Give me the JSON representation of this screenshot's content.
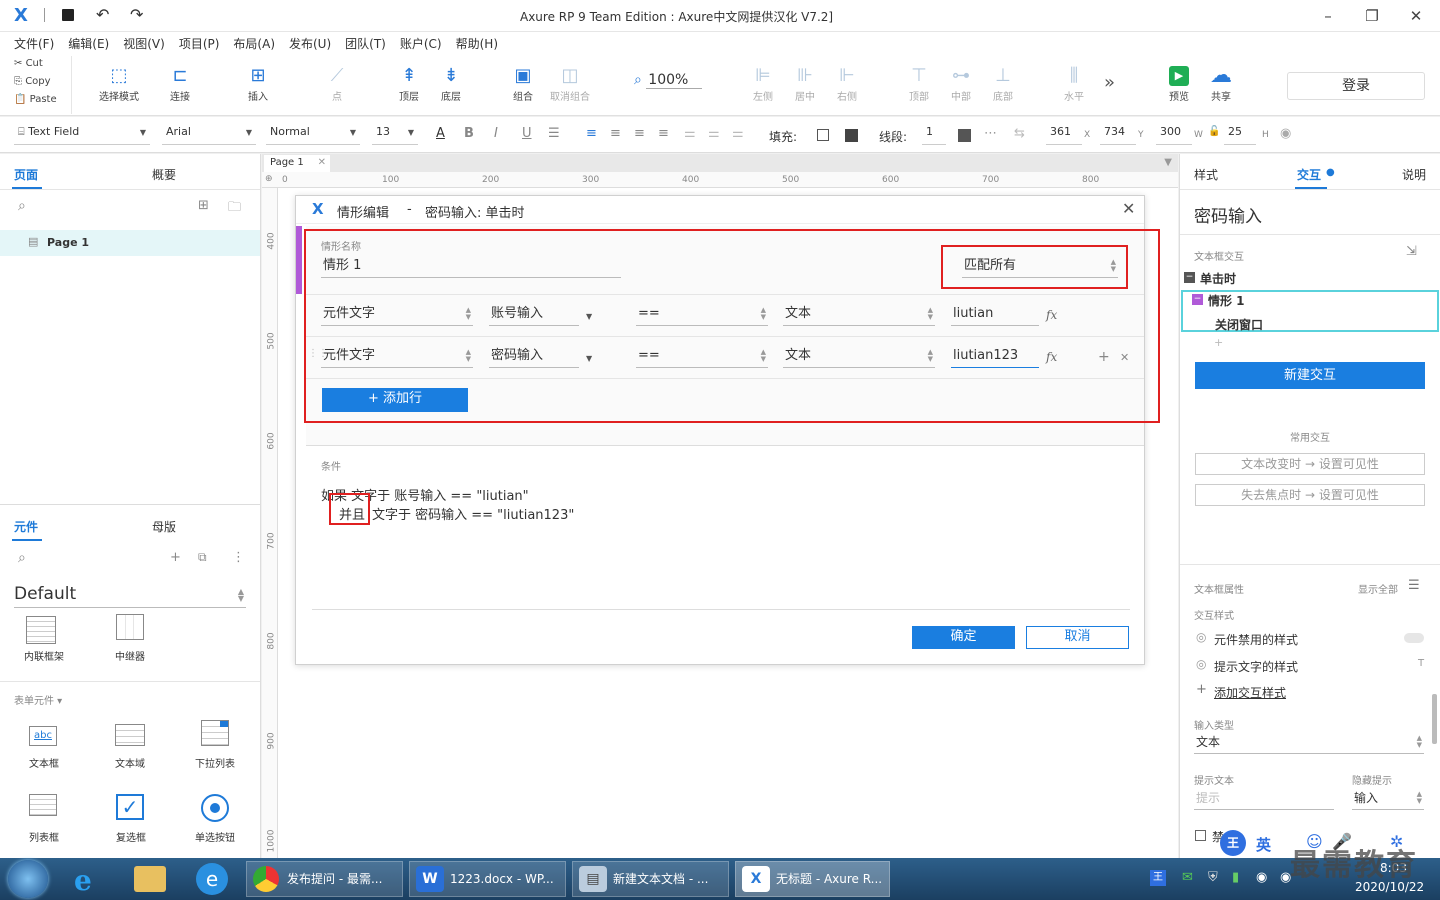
{
  "title": {
    "text": "Axure RP 9 Team Edition :          Axure中文网提供汉化 V7.2]"
  },
  "menu": [
    "文件(F)",
    "编辑(E)",
    "视图(V)",
    "项目(P)",
    "布局(A)",
    "发布(U)",
    "团队(T)",
    "账户(C)",
    "帮助(H)"
  ],
  "clipboard": [
    "Cut",
    "Copy",
    "Paste"
  ],
  "toolbar": {
    "select_mode": "选择模式",
    "connect": "连接",
    "insert": "插入",
    "point": "点",
    "top": "顶层",
    "bottom": "底层",
    "group": "组合",
    "ungroup": "取消组合",
    "zoom": "100%",
    "left": "左侧",
    "center": "居中",
    "right": "右侧",
    "top_align": "顶部",
    "middle": "中部",
    "bottom_align": "底部",
    "horizontal": "水平",
    "preview": "预览",
    "share": "共享",
    "login": "登录"
  },
  "format": {
    "widget_type": "Text Field",
    "font": "Arial",
    "style": "Normal",
    "size": "13",
    "fill_label": "填充:",
    "stroke_label": "线段:",
    "stroke_value": "1",
    "x": "361",
    "x_label": "X",
    "y": "734",
    "y_label": "Y",
    "w": "300",
    "w_label": "W",
    "h": "25",
    "h_label": "H"
  },
  "left": {
    "tab_pages": "页面",
    "tab_outline": "概要",
    "page_item": "Page 1",
    "tab_widgets": "元件",
    "tab_masters": "母版",
    "library": "Default",
    "widgets_top": [
      "内联框架",
      "中继器"
    ],
    "form_section": "表单元件",
    "widgets": [
      "文本框",
      "文本域",
      "下拉列表",
      "列表框",
      "复选框",
      "单选按钮"
    ]
  },
  "canvas": {
    "page_tab": "Page 1",
    "ruler_x": [
      "0",
      "100",
      "200",
      "300",
      "400",
      "500",
      "600",
      "700",
      "800"
    ],
    "ruler_y": [
      "400",
      "500",
      "600",
      "700",
      "800",
      "900",
      "1000"
    ]
  },
  "dialog": {
    "title": "情形编辑",
    "sep": "-",
    "subtitle": "密码输入: 单击时",
    "case_name_label": "情形名称",
    "case_name": "情形 1",
    "match": "匹配所有",
    "rows": [
      {
        "type": "元件文字",
        "target": "账号输入",
        "op": "==",
        "value_type": "文本",
        "value": "liutian"
      },
      {
        "type": "元件文字",
        "target": "密码输入",
        "op": "==",
        "value_type": "文本",
        "value": "liutian123"
      }
    ],
    "fx": "fx",
    "add_row": "+ 添加行",
    "cond_label": "条件",
    "cond_line1": "如果 文字于 账号输入 == \"liutian\"",
    "cond_and": "并且",
    "cond_line2": "文字于 密码输入 == \"liutian123\"",
    "ok": "确定",
    "cancel": "取消"
  },
  "right": {
    "tab_style": "样式",
    "tab_interact": "交互",
    "tab_notes": "说明",
    "widget_name": "密码输入",
    "section_label": "文本框交互",
    "event": "单击时",
    "case": "情形 1",
    "action": "关闭窗口",
    "new_interaction": "新建交互",
    "common_label": "常用交互",
    "common": [
      "文本改变时 → 设置可见性",
      "失去焦点时 → 设置可见性"
    ],
    "props_label": "文本框属性",
    "show_all": "显示全部",
    "interaction_styles": "交互样式",
    "style_items": [
      "元件禁用的样式",
      "提示文字的样式"
    ],
    "add_style": "添加交互样式",
    "input_type_label": "输入类型",
    "input_type": "文本",
    "hint_label": "提示文本",
    "hint_placeholder": "提示",
    "hide_label": "隐藏提示",
    "hide_value": "输入",
    "bottom_text": "禁"
  },
  "taskbar": {
    "tasks": [
      "发布提问 - 最需...",
      "1223.docx - WP...",
      "新建文本文档 - ...",
      "无标题 - Axure R..."
    ],
    "time": "8:03",
    "date": "2020/10/22",
    "ime": "英",
    "watermark": "最需教育"
  }
}
